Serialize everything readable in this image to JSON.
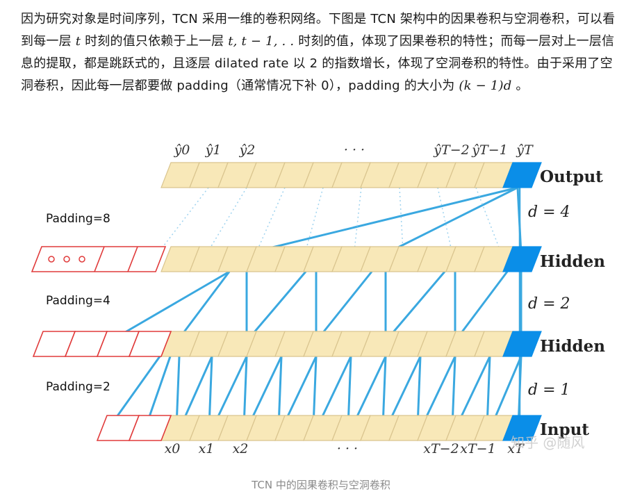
{
  "article": {
    "p1": "因为研究对象是时间序列，TCN 采用一维的卷积网络。下图是 TCN 架构中的因果卷积与空洞卷积，可以看到每一层",
    "p1_math1": "t",
    "p1b": " 时刻的值只依赖于上一层 ",
    "p1_math2": "t, t − 1, . .",
    "p1c": " 时刻的值，体现了因果卷积的特性；而每一层对上一层信息的提取，都是跳跃式的，且逐层 dilated rate 以 2 的指数增长，体现了空洞卷积的特性。由于采用了空洞卷积，因此每一层都要做 padding（通常情况下补 0），padding 的大小为 ",
    "p1_math3": "(k − 1)d",
    "p1d": " 。"
  },
  "figure": {
    "top_labels": [
      "ŷ0",
      "ŷ1",
      "ŷ2",
      "· · ·",
      "ŷT−2",
      "ŷT−1",
      "ŷT"
    ],
    "bottom_labels": [
      "x0",
      "x1",
      "x2",
      "· · ·",
      "xT−2",
      "xT−1",
      "xT"
    ],
    "layer_labels": [
      "Output",
      "Hidden",
      "Hidden",
      "Input"
    ],
    "dilations": [
      "d = 4",
      "d = 2",
      "d = 1"
    ],
    "paddings": [
      "Padding=8",
      "Padding=4",
      "Padding=2"
    ],
    "watermark": "知乎 @随风",
    "colors": {
      "cell_fill": "#f8e8b8",
      "cell_stroke": "#d9c48e",
      "highlight": "#0a8ee8",
      "line": "#3aa8e0",
      "padding_stroke": "#e03a3a"
    }
  },
  "caption": "TCN 中的因果卷积与空洞卷积"
}
